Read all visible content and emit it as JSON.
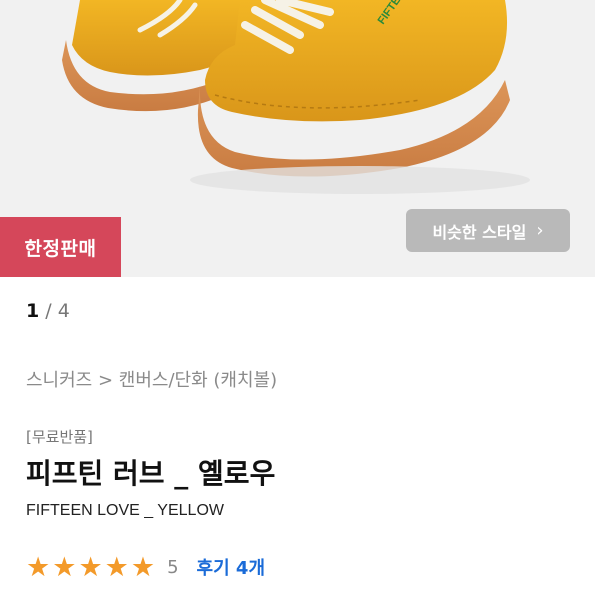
{
  "product_image": {
    "shoe_color": "#e9a81d",
    "sole_color": "#d2874d",
    "logo_text": "FIFTEEN"
  },
  "badge": {
    "label": "한정판매",
    "color": "#d5475a"
  },
  "similar_style_button": {
    "label": "비슷한 스타일",
    "icon": "chevron-right-icon"
  },
  "pager": {
    "current": "1",
    "separator": " / ",
    "total": "4"
  },
  "breadcrumb": {
    "category": "스니커즈",
    "separator": " > ",
    "subcategory": "캔버스/단화 (캐치볼)"
  },
  "product": {
    "tag": "[무료반품]",
    "title": "피프틴 러브 _ 옐로우",
    "subtitle": "FIFTEEN LOVE _ YELLOW"
  },
  "rating": {
    "stars_filled": 5,
    "stars_total": 5,
    "score": "5",
    "reviews_label": "후기 4개",
    "star_color": "#f39a2a",
    "link_color": "#1a6bd8"
  }
}
